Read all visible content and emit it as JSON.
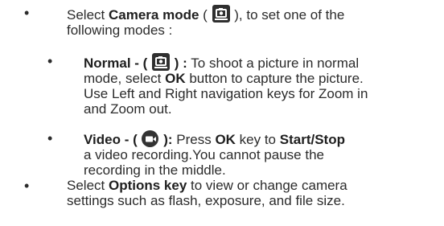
{
  "bullet_symbol": "•",
  "items": [
    {
      "lead": "Select ",
      "bold": "Camera mode",
      "before_icon": " ( ",
      "icon": "camera-icon",
      "after_icon": " ), to set one of the",
      "line2": "following modes :"
    },
    {
      "bold1": "Normal - ( ",
      "icon": "camera-icon",
      "bold2": " ) :",
      "text1": " To shoot a picture in normal",
      "line2_a": "mode, select ",
      "line2_bold": "OK",
      "line2_b": " button to capture the picture.",
      "line3": "Use Left and Right navigation keys for Zoom in",
      "line4": "and Zoom out."
    },
    {
      "bold1": "Video - ( ",
      "icon": "video-icon",
      "bold2": " ):",
      "text1": " Press ",
      "bold3": "OK",
      "text2": " key to ",
      "bold4": "Start/Stop",
      "line2": "a video recording.You cannot pause the",
      "line3": "recording in the middle."
    },
    {
      "lead": "Select ",
      "bold": "Options key",
      "text1": " to view or change camera",
      "line2": "settings such as flash, exposure, and file size."
    }
  ]
}
